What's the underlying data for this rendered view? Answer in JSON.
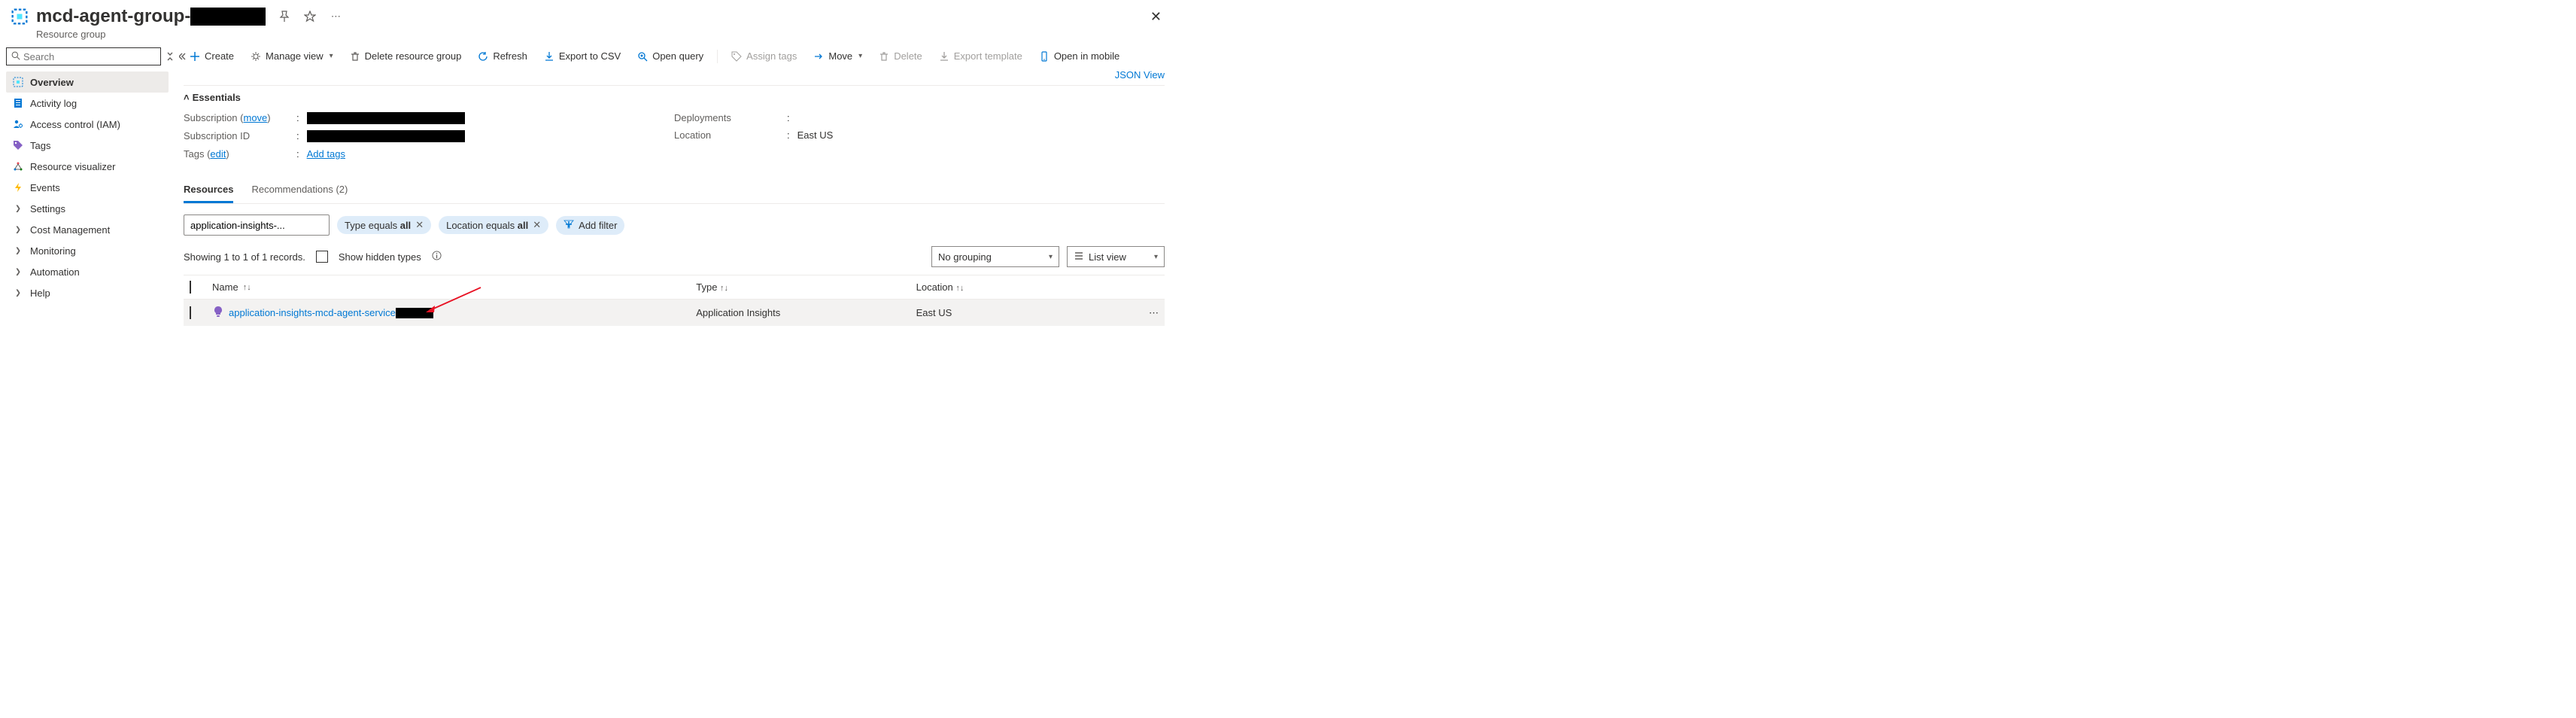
{
  "header": {
    "title_prefix": "mcd-agent-group-",
    "subtitle": "Resource group"
  },
  "sidebar": {
    "search_placeholder": "Search",
    "items": [
      {
        "label": "Overview"
      },
      {
        "label": "Activity log"
      },
      {
        "label": "Access control (IAM)"
      },
      {
        "label": "Tags"
      },
      {
        "label": "Resource visualizer"
      },
      {
        "label": "Events"
      },
      {
        "label": "Settings"
      },
      {
        "label": "Cost Management"
      },
      {
        "label": "Monitoring"
      },
      {
        "label": "Automation"
      },
      {
        "label": "Help"
      }
    ]
  },
  "toolbar": {
    "create": "Create",
    "manage_view": "Manage view",
    "delete_rg": "Delete resource group",
    "refresh": "Refresh",
    "export_csv": "Export to CSV",
    "open_query": "Open query",
    "assign_tags": "Assign tags",
    "move": "Move",
    "delete": "Delete",
    "export_template": "Export template",
    "open_mobile": "Open in mobile",
    "json_view": "JSON View"
  },
  "essentials": {
    "title": "Essentials",
    "subscription_label": "Subscription",
    "subscription_move": "move",
    "subscription_id_label": "Subscription ID",
    "tags_label": "Tags",
    "tags_edit": "edit",
    "add_tags": "Add tags",
    "deployments_label": "Deployments",
    "location_label": "Location",
    "location_value": "East US"
  },
  "tabs": {
    "resources": "Resources",
    "recommendations": "Recommendations (2)"
  },
  "filters": {
    "input_value": "application-insights-...",
    "type_pill": "Type equals ",
    "type_value": "all",
    "location_pill": "Location equals ",
    "location_value": "all",
    "add": "Add filter"
  },
  "records": {
    "showing": "Showing 1 to 1 of 1 records.",
    "show_hidden": "Show hidden types",
    "grouping": "No grouping",
    "list_view": "List view"
  },
  "table": {
    "headers": {
      "name": "Name",
      "type": "Type",
      "location": "Location"
    },
    "rows": [
      {
        "name_prefix": "application-insights-mcd-agent-service",
        "type": "Application Insights",
        "location": "East US"
      }
    ]
  }
}
